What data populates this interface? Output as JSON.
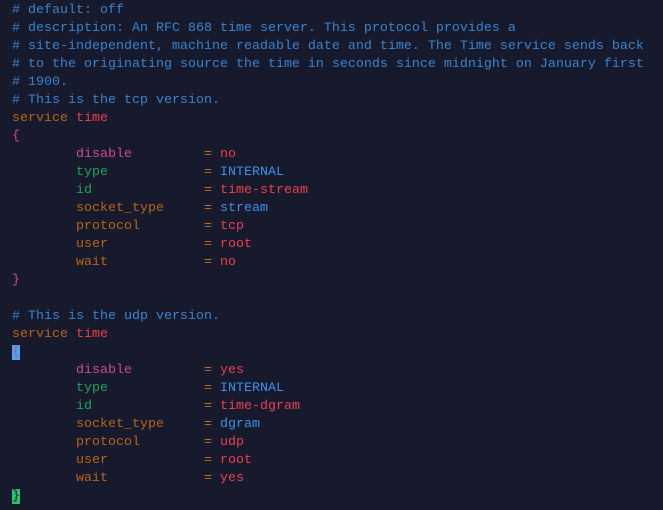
{
  "editor": {
    "lines": [
      [
        {
          "t": "# default: off",
          "c": "comment"
        }
      ],
      [
        {
          "t": "# description: An RFC 868 time server. This protocol provides a",
          "c": "comment"
        }
      ],
      [
        {
          "t": "# site-independent, machine readable date and time. The Time service sends back",
          "c": "comment"
        }
      ],
      [
        {
          "t": "# to the originating source the time in seconds since midnight on January first",
          "c": "comment"
        }
      ],
      [
        {
          "t": "# 1900.",
          "c": "comment"
        }
      ],
      [
        {
          "t": "# This is the tcp version.",
          "c": "comment"
        }
      ],
      [
        {
          "t": "service ",
          "c": "kw"
        },
        {
          "t": "time",
          "c": "name"
        }
      ],
      [
        {
          "t": "{",
          "c": "brace"
        }
      ],
      [
        {
          "t": "        disable         ",
          "c": "pink"
        },
        {
          "t": "= ",
          "c": "op"
        },
        {
          "t": "no",
          "c": "red"
        }
      ],
      [
        {
          "t": "        type            ",
          "c": "green"
        },
        {
          "t": "= ",
          "c": "op"
        },
        {
          "t": "INTERNAL",
          "c": "blue"
        }
      ],
      [
        {
          "t": "        id              ",
          "c": "green"
        },
        {
          "t": "= ",
          "c": "op"
        },
        {
          "t": "time-stream",
          "c": "red"
        }
      ],
      [
        {
          "t": "        socket_type     ",
          "c": "orange"
        },
        {
          "t": "= ",
          "c": "op"
        },
        {
          "t": "stream",
          "c": "blue"
        }
      ],
      [
        {
          "t": "        protocol        ",
          "c": "orange"
        },
        {
          "t": "= ",
          "c": "op"
        },
        {
          "t": "tcp",
          "c": "red"
        }
      ],
      [
        {
          "t": "        user            ",
          "c": "orange"
        },
        {
          "t": "= ",
          "c": "op"
        },
        {
          "t": "root",
          "c": "red"
        }
      ],
      [
        {
          "t": "        wait            ",
          "c": "orange"
        },
        {
          "t": "= ",
          "c": "op"
        },
        {
          "t": "no",
          "c": "red"
        }
      ],
      [
        {
          "t": "}",
          "c": "brace"
        }
      ],
      [],
      [
        {
          "t": "# This is the udp version.",
          "c": "comment"
        }
      ],
      [
        {
          "t": "service ",
          "c": "kw"
        },
        {
          "t": "time",
          "c": "name"
        }
      ],
      [
        {
          "t": "{",
          "c": "cursor-blue"
        }
      ],
      [
        {
          "t": "        disable         ",
          "c": "pink"
        },
        {
          "t": "= ",
          "c": "op"
        },
        {
          "t": "yes",
          "c": "red"
        }
      ],
      [
        {
          "t": "        type            ",
          "c": "green"
        },
        {
          "t": "= ",
          "c": "op"
        },
        {
          "t": "INTERNAL",
          "c": "blue"
        }
      ],
      [
        {
          "t": "        id              ",
          "c": "green"
        },
        {
          "t": "= ",
          "c": "op"
        },
        {
          "t": "time-dgram",
          "c": "red"
        }
      ],
      [
        {
          "t": "        socket_type     ",
          "c": "orange"
        },
        {
          "t": "= ",
          "c": "op"
        },
        {
          "t": "dgram",
          "c": "blue"
        }
      ],
      [
        {
          "t": "        protocol        ",
          "c": "orange"
        },
        {
          "t": "= ",
          "c": "op"
        },
        {
          "t": "udp",
          "c": "red"
        }
      ],
      [
        {
          "t": "        user            ",
          "c": "orange"
        },
        {
          "t": "= ",
          "c": "op"
        },
        {
          "t": "root",
          "c": "red"
        }
      ],
      [
        {
          "t": "        wait            ",
          "c": "orange"
        },
        {
          "t": "= ",
          "c": "op"
        },
        {
          "t": "yes",
          "c": "red"
        }
      ],
      [
        {
          "t": "}",
          "c": "cursor-green"
        }
      ]
    ]
  }
}
